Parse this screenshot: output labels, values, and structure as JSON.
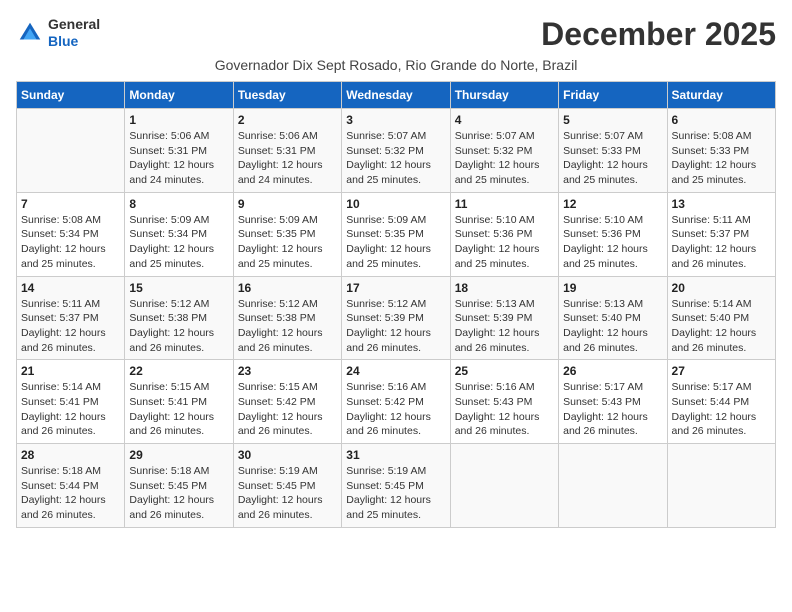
{
  "logo": {
    "line1": "General",
    "line2": "Blue"
  },
  "title": "December 2025",
  "subtitle": "Governador Dix Sept Rosado, Rio Grande do Norte, Brazil",
  "days_of_week": [
    "Sunday",
    "Monday",
    "Tuesday",
    "Wednesday",
    "Thursday",
    "Friday",
    "Saturday"
  ],
  "weeks": [
    [
      {
        "day": "",
        "info": ""
      },
      {
        "day": "1",
        "info": "Sunrise: 5:06 AM\nSunset: 5:31 PM\nDaylight: 12 hours\nand 24 minutes."
      },
      {
        "day": "2",
        "info": "Sunrise: 5:06 AM\nSunset: 5:31 PM\nDaylight: 12 hours\nand 24 minutes."
      },
      {
        "day": "3",
        "info": "Sunrise: 5:07 AM\nSunset: 5:32 PM\nDaylight: 12 hours\nand 25 minutes."
      },
      {
        "day": "4",
        "info": "Sunrise: 5:07 AM\nSunset: 5:32 PM\nDaylight: 12 hours\nand 25 minutes."
      },
      {
        "day": "5",
        "info": "Sunrise: 5:07 AM\nSunset: 5:33 PM\nDaylight: 12 hours\nand 25 minutes."
      },
      {
        "day": "6",
        "info": "Sunrise: 5:08 AM\nSunset: 5:33 PM\nDaylight: 12 hours\nand 25 minutes."
      }
    ],
    [
      {
        "day": "7",
        "info": "Sunrise: 5:08 AM\nSunset: 5:34 PM\nDaylight: 12 hours\nand 25 minutes."
      },
      {
        "day": "8",
        "info": "Sunrise: 5:09 AM\nSunset: 5:34 PM\nDaylight: 12 hours\nand 25 minutes."
      },
      {
        "day": "9",
        "info": "Sunrise: 5:09 AM\nSunset: 5:35 PM\nDaylight: 12 hours\nand 25 minutes."
      },
      {
        "day": "10",
        "info": "Sunrise: 5:09 AM\nSunset: 5:35 PM\nDaylight: 12 hours\nand 25 minutes."
      },
      {
        "day": "11",
        "info": "Sunrise: 5:10 AM\nSunset: 5:36 PM\nDaylight: 12 hours\nand 25 minutes."
      },
      {
        "day": "12",
        "info": "Sunrise: 5:10 AM\nSunset: 5:36 PM\nDaylight: 12 hours\nand 25 minutes."
      },
      {
        "day": "13",
        "info": "Sunrise: 5:11 AM\nSunset: 5:37 PM\nDaylight: 12 hours\nand 26 minutes."
      }
    ],
    [
      {
        "day": "14",
        "info": "Sunrise: 5:11 AM\nSunset: 5:37 PM\nDaylight: 12 hours\nand 26 minutes."
      },
      {
        "day": "15",
        "info": "Sunrise: 5:12 AM\nSunset: 5:38 PM\nDaylight: 12 hours\nand 26 minutes."
      },
      {
        "day": "16",
        "info": "Sunrise: 5:12 AM\nSunset: 5:38 PM\nDaylight: 12 hours\nand 26 minutes."
      },
      {
        "day": "17",
        "info": "Sunrise: 5:12 AM\nSunset: 5:39 PM\nDaylight: 12 hours\nand 26 minutes."
      },
      {
        "day": "18",
        "info": "Sunrise: 5:13 AM\nSunset: 5:39 PM\nDaylight: 12 hours\nand 26 minutes."
      },
      {
        "day": "19",
        "info": "Sunrise: 5:13 AM\nSunset: 5:40 PM\nDaylight: 12 hours\nand 26 minutes."
      },
      {
        "day": "20",
        "info": "Sunrise: 5:14 AM\nSunset: 5:40 PM\nDaylight: 12 hours\nand 26 minutes."
      }
    ],
    [
      {
        "day": "21",
        "info": "Sunrise: 5:14 AM\nSunset: 5:41 PM\nDaylight: 12 hours\nand 26 minutes."
      },
      {
        "day": "22",
        "info": "Sunrise: 5:15 AM\nSunset: 5:41 PM\nDaylight: 12 hours\nand 26 minutes."
      },
      {
        "day": "23",
        "info": "Sunrise: 5:15 AM\nSunset: 5:42 PM\nDaylight: 12 hours\nand 26 minutes."
      },
      {
        "day": "24",
        "info": "Sunrise: 5:16 AM\nSunset: 5:42 PM\nDaylight: 12 hours\nand 26 minutes."
      },
      {
        "day": "25",
        "info": "Sunrise: 5:16 AM\nSunset: 5:43 PM\nDaylight: 12 hours\nand 26 minutes."
      },
      {
        "day": "26",
        "info": "Sunrise: 5:17 AM\nSunset: 5:43 PM\nDaylight: 12 hours\nand 26 minutes."
      },
      {
        "day": "27",
        "info": "Sunrise: 5:17 AM\nSunset: 5:44 PM\nDaylight: 12 hours\nand 26 minutes."
      }
    ],
    [
      {
        "day": "28",
        "info": "Sunrise: 5:18 AM\nSunset: 5:44 PM\nDaylight: 12 hours\nand 26 minutes."
      },
      {
        "day": "29",
        "info": "Sunrise: 5:18 AM\nSunset: 5:45 PM\nDaylight: 12 hours\nand 26 minutes."
      },
      {
        "day": "30",
        "info": "Sunrise: 5:19 AM\nSunset: 5:45 PM\nDaylight: 12 hours\nand 26 minutes."
      },
      {
        "day": "31",
        "info": "Sunrise: 5:19 AM\nSunset: 5:45 PM\nDaylight: 12 hours\nand 25 minutes."
      },
      {
        "day": "",
        "info": ""
      },
      {
        "day": "",
        "info": ""
      },
      {
        "day": "",
        "info": ""
      }
    ]
  ]
}
